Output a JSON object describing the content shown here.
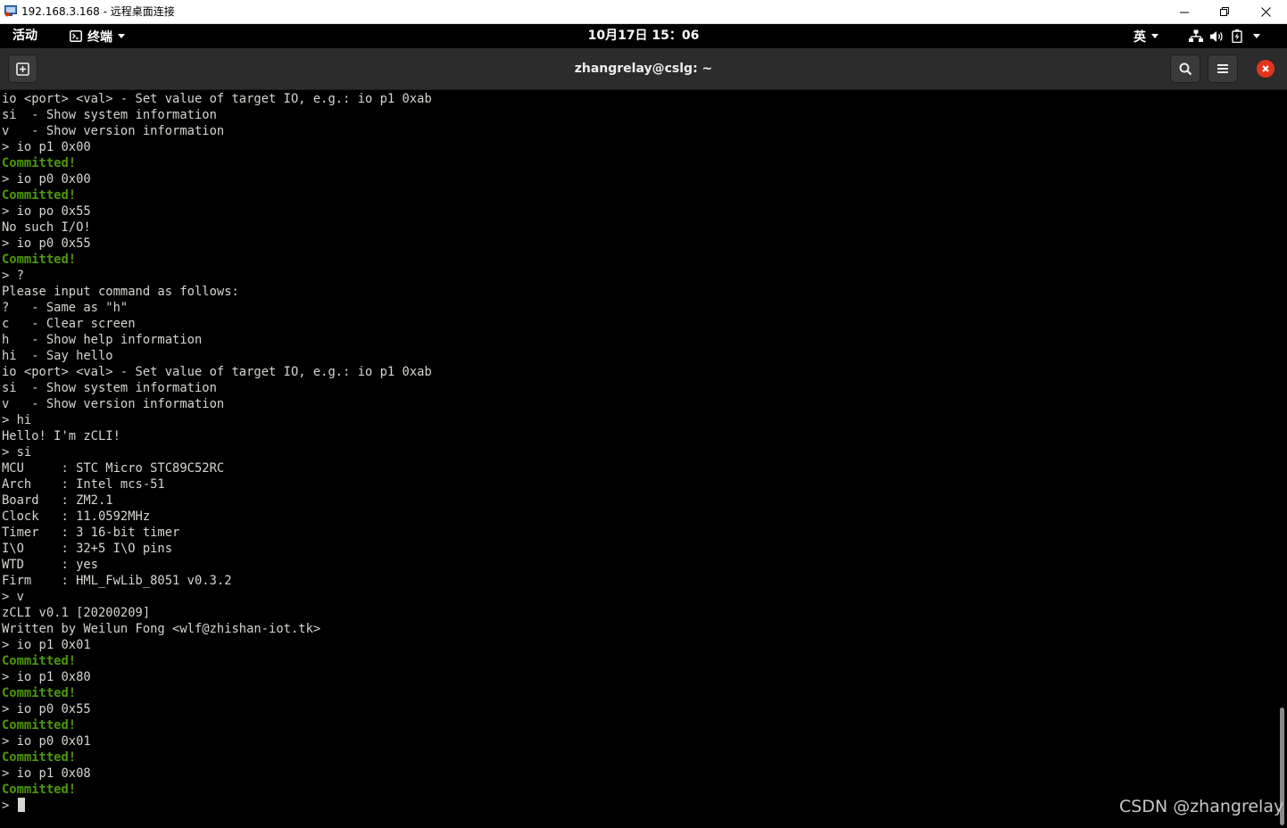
{
  "rdp_window": {
    "title": "192.168.3.168 - 远程桌面连接",
    "buttons": [
      "minimize",
      "restore",
      "close"
    ]
  },
  "gnome_bar": {
    "activities": "活动",
    "app_menu": "终端",
    "clock": "10月17日 15：06",
    "input_method": "英"
  },
  "terminal": {
    "title": "zhangrelay@cslg: ~",
    "lines": [
      {
        "text": "io <port> <val> - Set value of target IO, e.g.: io p1 0xab",
        "ok": false
      },
      {
        "text": "si  - Show system information",
        "ok": false
      },
      {
        "text": "v   - Show version information",
        "ok": false
      },
      {
        "text": "> io p1 0x00",
        "ok": false
      },
      {
        "text": "Committed!",
        "ok": true
      },
      {
        "text": "> io p0 0x00",
        "ok": false
      },
      {
        "text": "Committed!",
        "ok": true
      },
      {
        "text": "> io po 0x55",
        "ok": false
      },
      {
        "text": "No such I/O!",
        "ok": false
      },
      {
        "text": "> io p0 0x55",
        "ok": false
      },
      {
        "text": "Committed!",
        "ok": true
      },
      {
        "text": "> ?",
        "ok": false
      },
      {
        "text": "Please input command as follows:",
        "ok": false
      },
      {
        "text": "?   - Same as \"h\"",
        "ok": false
      },
      {
        "text": "c   - Clear screen",
        "ok": false
      },
      {
        "text": "h   - Show help information",
        "ok": false
      },
      {
        "text": "hi  - Say hello",
        "ok": false
      },
      {
        "text": "io <port> <val> - Set value of target IO, e.g.: io p1 0xab",
        "ok": false
      },
      {
        "text": "si  - Show system information",
        "ok": false
      },
      {
        "text": "v   - Show version information",
        "ok": false
      },
      {
        "text": "> hi",
        "ok": false
      },
      {
        "text": "Hello! I'm zCLI!",
        "ok": false
      },
      {
        "text": "> si",
        "ok": false
      },
      {
        "text": "MCU     : STC Micro STC89C52RC",
        "ok": false
      },
      {
        "text": "Arch    : Intel mcs-51",
        "ok": false
      },
      {
        "text": "Board   : ZM2.1",
        "ok": false
      },
      {
        "text": "Clock   : 11.0592MHz",
        "ok": false
      },
      {
        "text": "Timer   : 3 16-bit timer",
        "ok": false
      },
      {
        "text": "I\\O     : 32+5 I\\O pins",
        "ok": false
      },
      {
        "text": "WTD     : yes",
        "ok": false
      },
      {
        "text": "Firm    : HML_FwLib_8051 v0.3.2",
        "ok": false
      },
      {
        "text": "> v",
        "ok": false
      },
      {
        "text": "zCLI v0.1 [20200209]",
        "ok": false
      },
      {
        "text": "Written by Weilun Fong <wlf@zhishan-iot.tk>",
        "ok": false
      },
      {
        "text": "> io p1 0x01",
        "ok": false
      },
      {
        "text": "Committed!",
        "ok": true
      },
      {
        "text": "> io p1 0x80",
        "ok": false
      },
      {
        "text": "Committed!",
        "ok": true
      },
      {
        "text": "> io p0 0x55",
        "ok": false
      },
      {
        "text": "Committed!",
        "ok": true
      },
      {
        "text": "> io p0 0x01",
        "ok": false
      },
      {
        "text": "Committed!",
        "ok": true
      },
      {
        "text": "> io p1 0x08",
        "ok": false
      },
      {
        "text": "Committed!",
        "ok": true
      }
    ],
    "prompt": ">",
    "scroll_position": 0.84
  },
  "watermark": "CSDN @zhangrelay",
  "icons": {
    "terminal_app": "terminal-icon",
    "new_tab": "new-tab-icon",
    "search": "search-icon",
    "menu": "hamburger-menu-icon",
    "close": "close-icon",
    "network": "network-icon",
    "volume": "volume-icon",
    "battery": "battery-icon"
  },
  "colors": {
    "terminal_bg": "#000000",
    "terminal_fg": "#d3d7cf",
    "committed_green": "#4e9a06",
    "header_bg": "#2c2c2c",
    "close_red": "#e0361c"
  }
}
